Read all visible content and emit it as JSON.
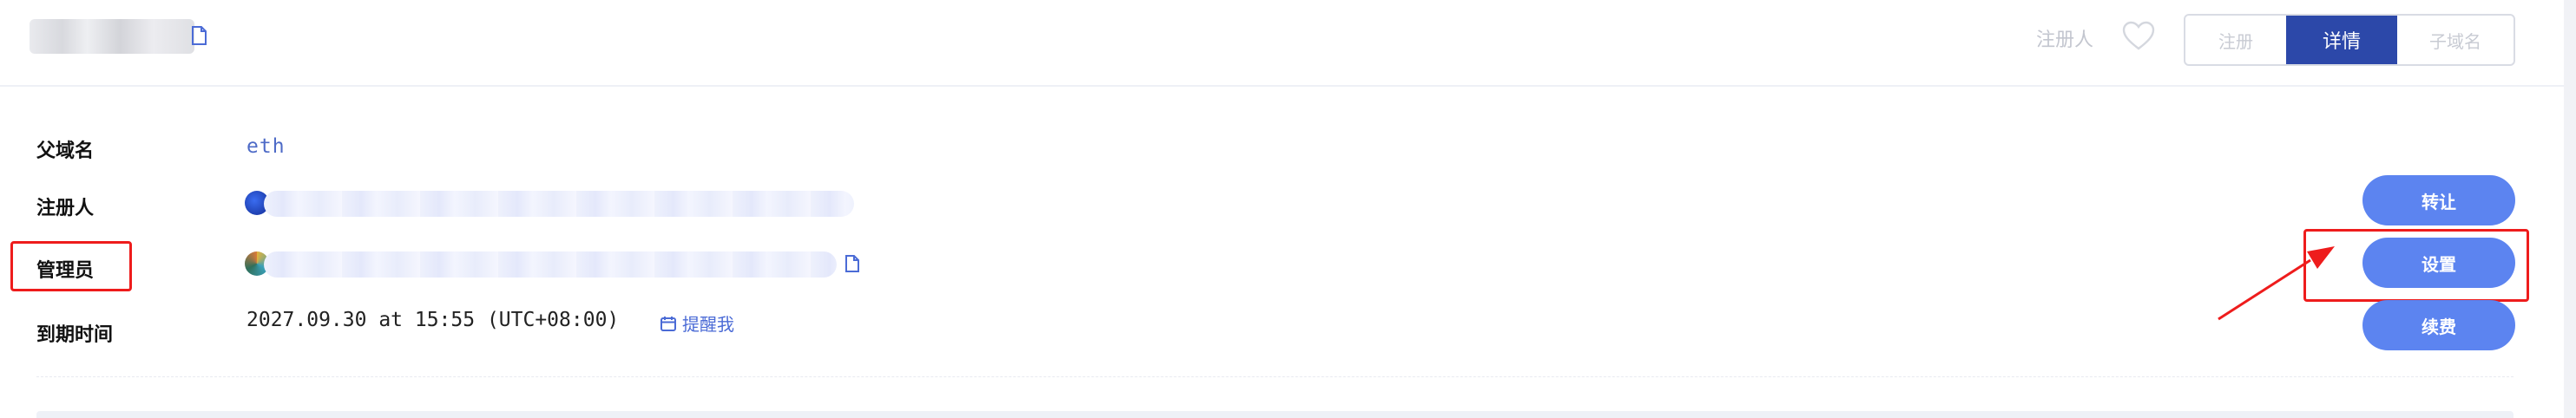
{
  "header": {
    "registrant_link": "注册人",
    "tabs": [
      {
        "label": "注册",
        "active": false
      },
      {
        "label": "详情",
        "active": true
      },
      {
        "label": "子域名",
        "active": false
      }
    ]
  },
  "details": {
    "parent": {
      "label": "父域名",
      "value": "eth"
    },
    "registrant": {
      "label": "注册人"
    },
    "controller": {
      "label": "管理员"
    },
    "expiry": {
      "label": "到期时间",
      "value": "2027.09.30 at 15:55 (UTC+08:00)",
      "remind_label": "提醒我"
    }
  },
  "actions": {
    "transfer": "转让",
    "settings": "设置",
    "renew": "续费"
  },
  "colors": {
    "accent": "#5c84f0",
    "tab_active": "#2c48a9",
    "highlight": "#ee1c1c",
    "link": "#4b6bd6"
  }
}
